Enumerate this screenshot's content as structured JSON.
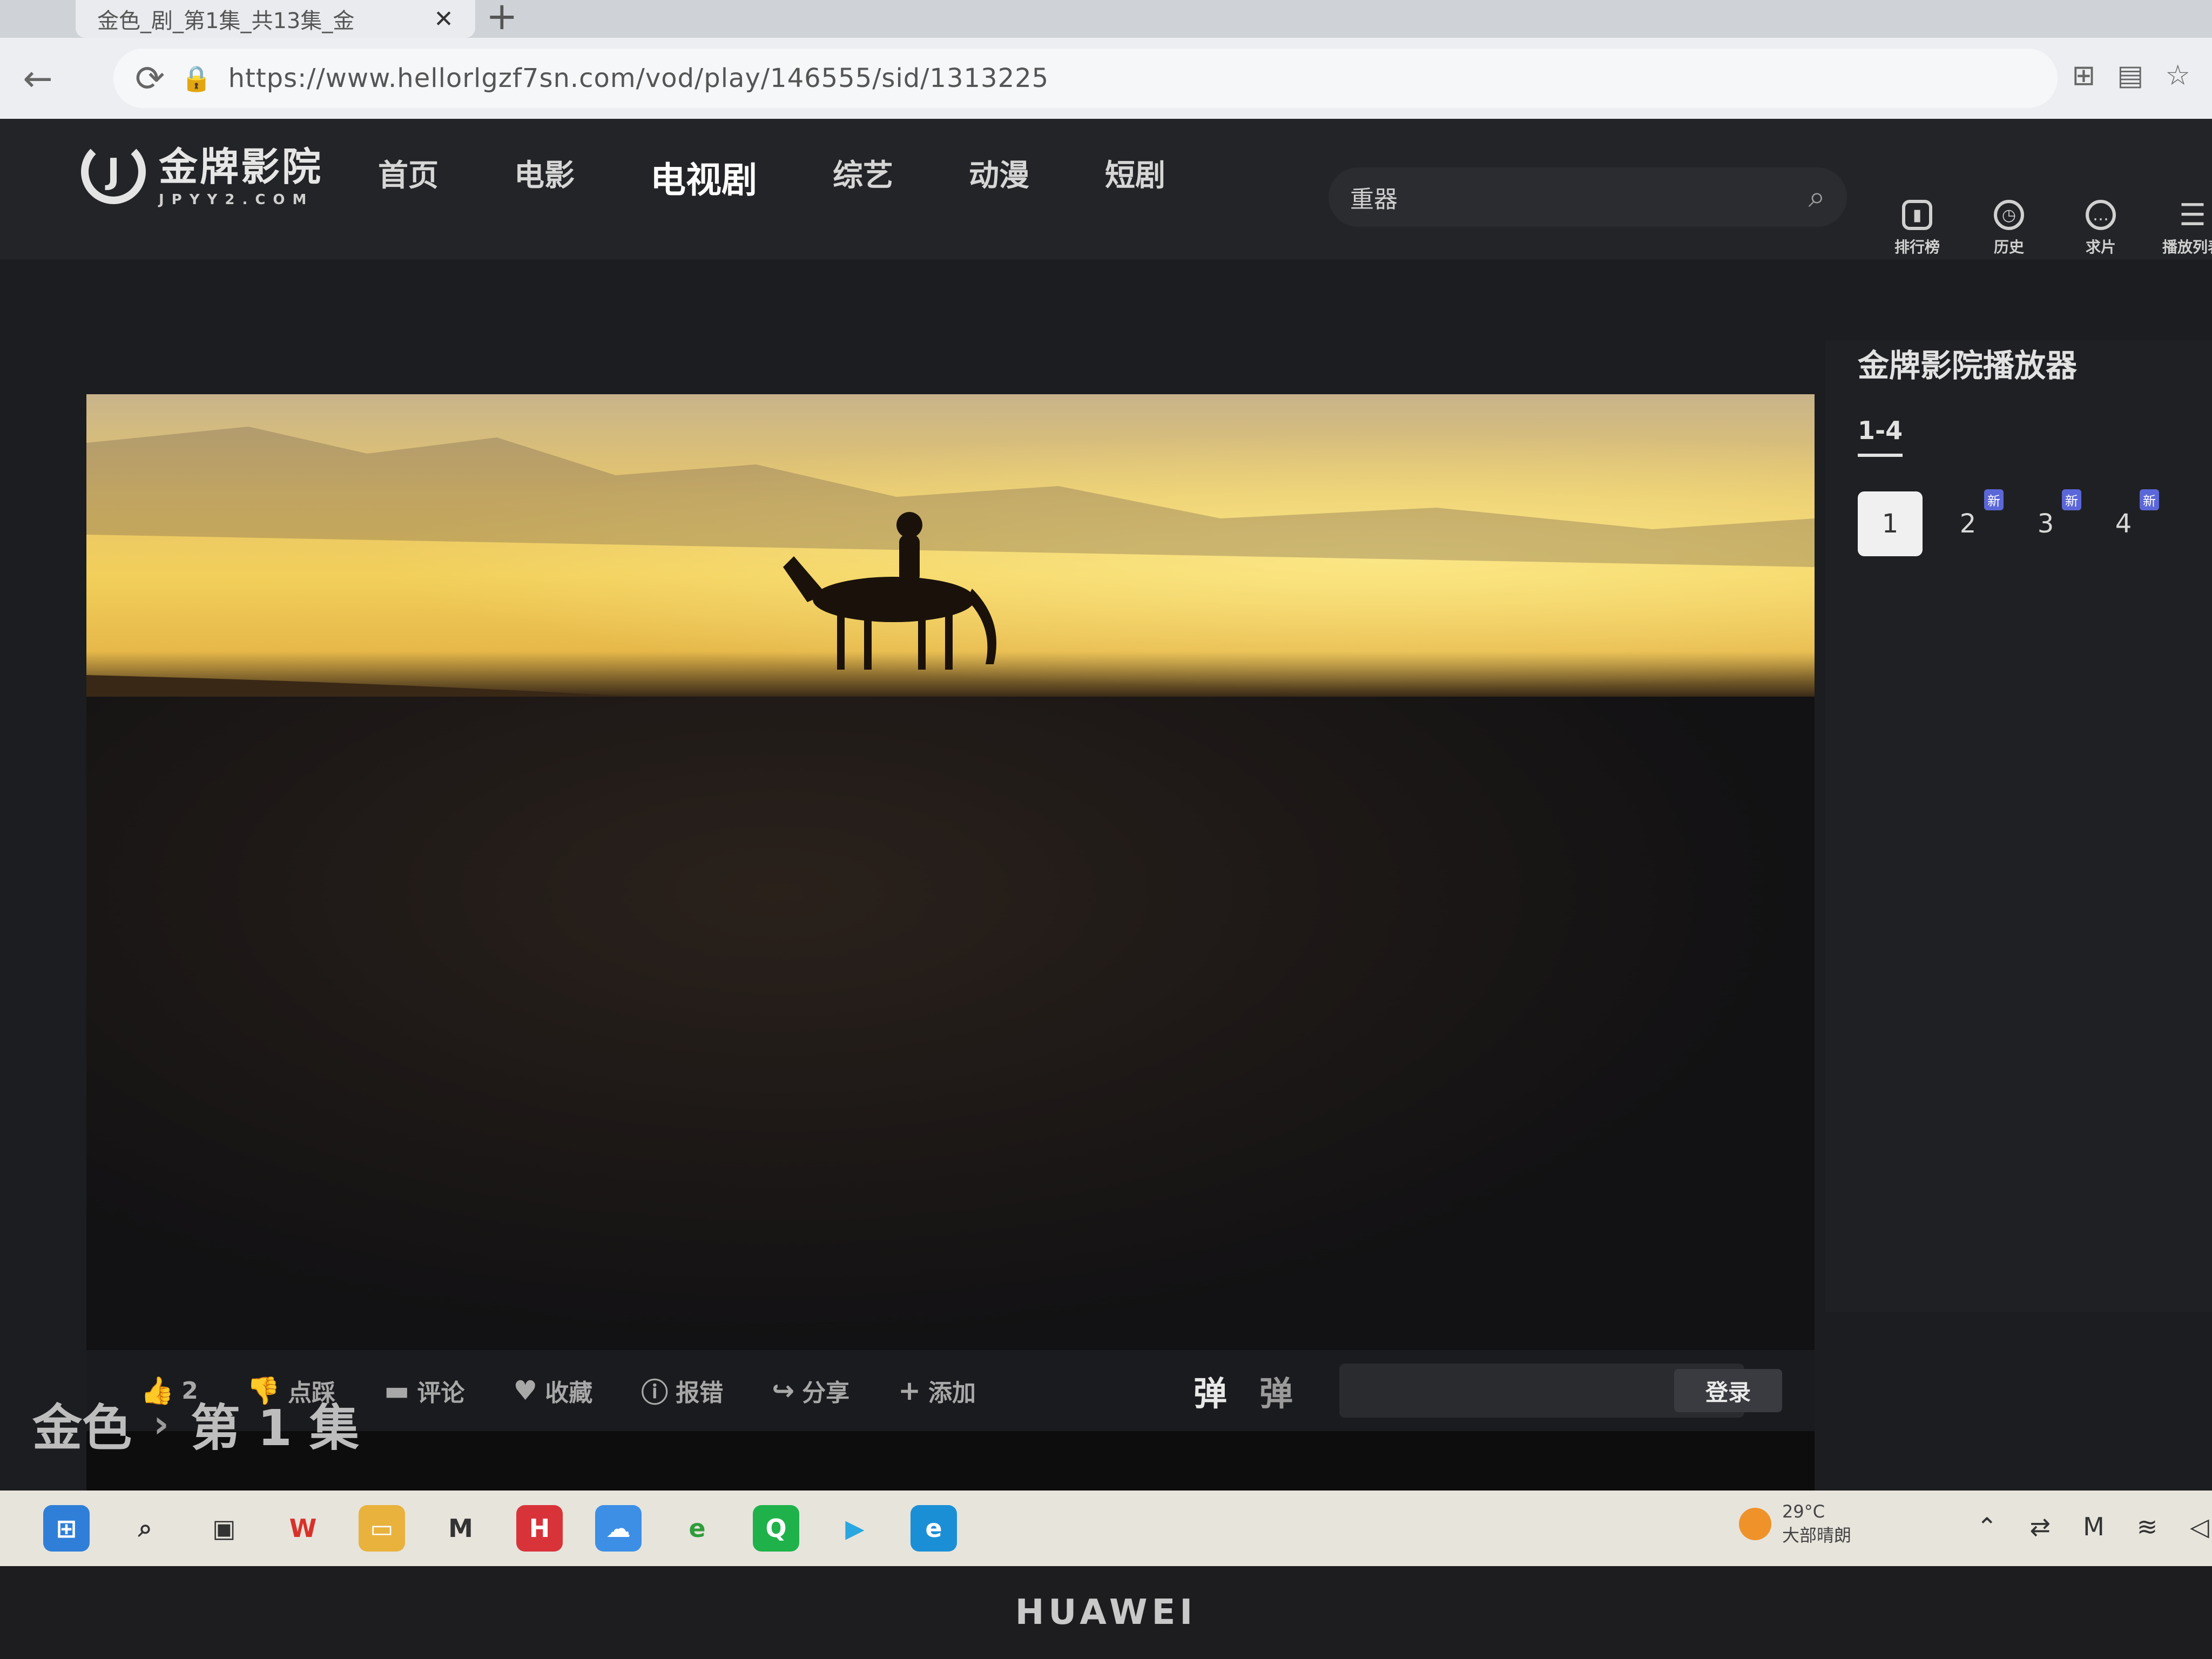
{
  "browser": {
    "tab_title": "金色_剧_第1集_共13集_金",
    "url": "https://www.hellorlgzf7sn.com/vod/play/146555/sid/1313225"
  },
  "site": {
    "logo_cn": "金牌影院",
    "logo_en": "JPYY2.COM",
    "nav": [
      {
        "label": "首页"
      },
      {
        "label": "电影"
      },
      {
        "label": "电视剧",
        "active": true
      },
      {
        "label": "综艺"
      },
      {
        "label": "动漫"
      },
      {
        "label": "短剧"
      }
    ],
    "search_value": "重器",
    "header_icons": [
      {
        "label": "排行榜",
        "icon": "chart-icon"
      },
      {
        "label": "历史",
        "icon": "clock-icon"
      },
      {
        "label": "求片",
        "icon": "chat-icon"
      },
      {
        "label": "播放列表",
        "icon": "playlist-icon"
      }
    ]
  },
  "player": {
    "actions": [
      {
        "label": "2",
        "icon": "thumbs-up-icon"
      },
      {
        "label": "点踩",
        "icon": "thumbs-down-icon"
      },
      {
        "label": "评论",
        "icon": "comment-icon"
      },
      {
        "label": "收藏",
        "icon": "heart-icon"
      },
      {
        "label": "报错",
        "icon": "alert-icon"
      },
      {
        "label": "分享",
        "icon": "share-icon"
      },
      {
        "label": "添加",
        "icon": "plus-icon"
      }
    ],
    "danmu_on": "弹",
    "danmu_settings": "弹",
    "login_label": "登录"
  },
  "breadcrumb": {
    "show": "金色",
    "episode": "第 1 集"
  },
  "side_panel": {
    "title": "金牌影院播放器",
    "range": "1-4",
    "episodes": [
      {
        "label": "1",
        "current": true,
        "badge": ""
      },
      {
        "label": "2",
        "badge": "新"
      },
      {
        "label": "3",
        "badge": "新"
      },
      {
        "label": "4",
        "badge": "新"
      }
    ]
  },
  "taskbar": {
    "temperature": "29°C",
    "weather": "大部晴朗",
    "apps": [
      "windows-start-icon",
      "search-icon",
      "task-view-icon",
      "wps-icon",
      "file-explorer-icon",
      "huawei-icon",
      "appgallery-icon",
      "cloud-icon",
      "ie-icon",
      "iqiyi-icon",
      "tencent-video-icon",
      "edge-icon"
    ]
  },
  "bezel": {
    "brand": "HUAWEI"
  },
  "colors": {
    "accent": "#5b67d8",
    "background": "#1c1d20"
  }
}
